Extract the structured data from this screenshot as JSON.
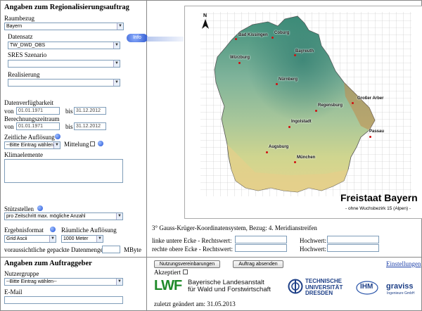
{
  "left": {
    "title": "Angaben zum Regionalisierungsauftrag",
    "raumbezug_label": "Raumbezug",
    "raumbezug_value": "Bayern",
    "datensatz_label": "Datensatz",
    "datensatz_value": "TW_DWD_OBS",
    "info_label": "Info",
    "sres_label": "SRES Szenario",
    "sres_value": "",
    "realisierung_label": "Realisierung",
    "realisierung_value": "",
    "verfuegbarkeit_label": "Datenverfügbarkeit",
    "von_label": "von",
    "bis_label": "bis",
    "verf_von": "01.01.1971",
    "verf_bis": "31.12.2012",
    "berechnung_label": "Berechnungszeitraum",
    "ber_von": "01.01.1971",
    "ber_bis": "31.12.2012",
    "aufloesung_label": "Zeitliche Auflösung",
    "aufloesung_value": "--Bitte Eintrag wählen--",
    "mittelung_label": "Mittelung",
    "klima_label": "Klimaelemente",
    "stuetz_label": "Stützstellen",
    "stuetz_value": "pro Zeitschritt max. mögliche Anzahl",
    "ergebnis_label": "Ergebnisformat",
    "ergebnis_value": "Grid Ascii",
    "raeuml_label": "Räumliche Auflösung",
    "raeuml_value": "1000 Meter",
    "datenmenge_label": "voraussichtliche gepackte Datenmenge:",
    "datenmenge_unit": "MByte"
  },
  "bottom_left": {
    "title": "Angaben zum Auftraggeber",
    "nutzergruppe_label": "Nutzergruppe",
    "nutzergruppe_value": "--Bitte Eintrag wählen--",
    "email_label": "E-Mail"
  },
  "map": {
    "title": "Freistaat Bayern",
    "subtitle": "- ohne Wuchsbezirk 15 (Alpen) -",
    "north": "N",
    "cities": [
      "Bad Kissingen",
      "Coburg",
      "Bayreuth",
      "Würzburg",
      "Nürnberg",
      "Großer Arber",
      "Regensburg",
      "Ingolstadt",
      "Passau",
      "Augsburg",
      "München"
    ]
  },
  "coords": {
    "crs_text": "3° Gauss-Krüger-Koordinatensystem, Bezug: 4. Meridianstreifen",
    "lower_left_label": "linke untere Ecke  - Rechtswert:",
    "upper_right_label": "rechte obere Ecke  - Rechtswert:",
    "hochwert_label": "Hochwert:"
  },
  "actions": {
    "terms_button": "Nutzungsvereinbarungen",
    "submit_button": "Auftrag absenden",
    "settings_link": "Einstellungen",
    "accepted_label": "Akzeptiert"
  },
  "footer": {
    "lwf_abbr": "LWF",
    "lwf_line1": "Bayerische Landesanstalt",
    "lwf_line2": "für Wald und Forstwirtschaft",
    "tu_line1": "TECHNISCHE",
    "tu_line2": "UNIVERSITÄT",
    "tu_line3": "DRESDEN",
    "ihm": "IHM",
    "graviss": "graviss",
    "graviss_sub": "Ingenieure GmbH",
    "changed": "zuletzt geändert am: 31.05.2013"
  }
}
